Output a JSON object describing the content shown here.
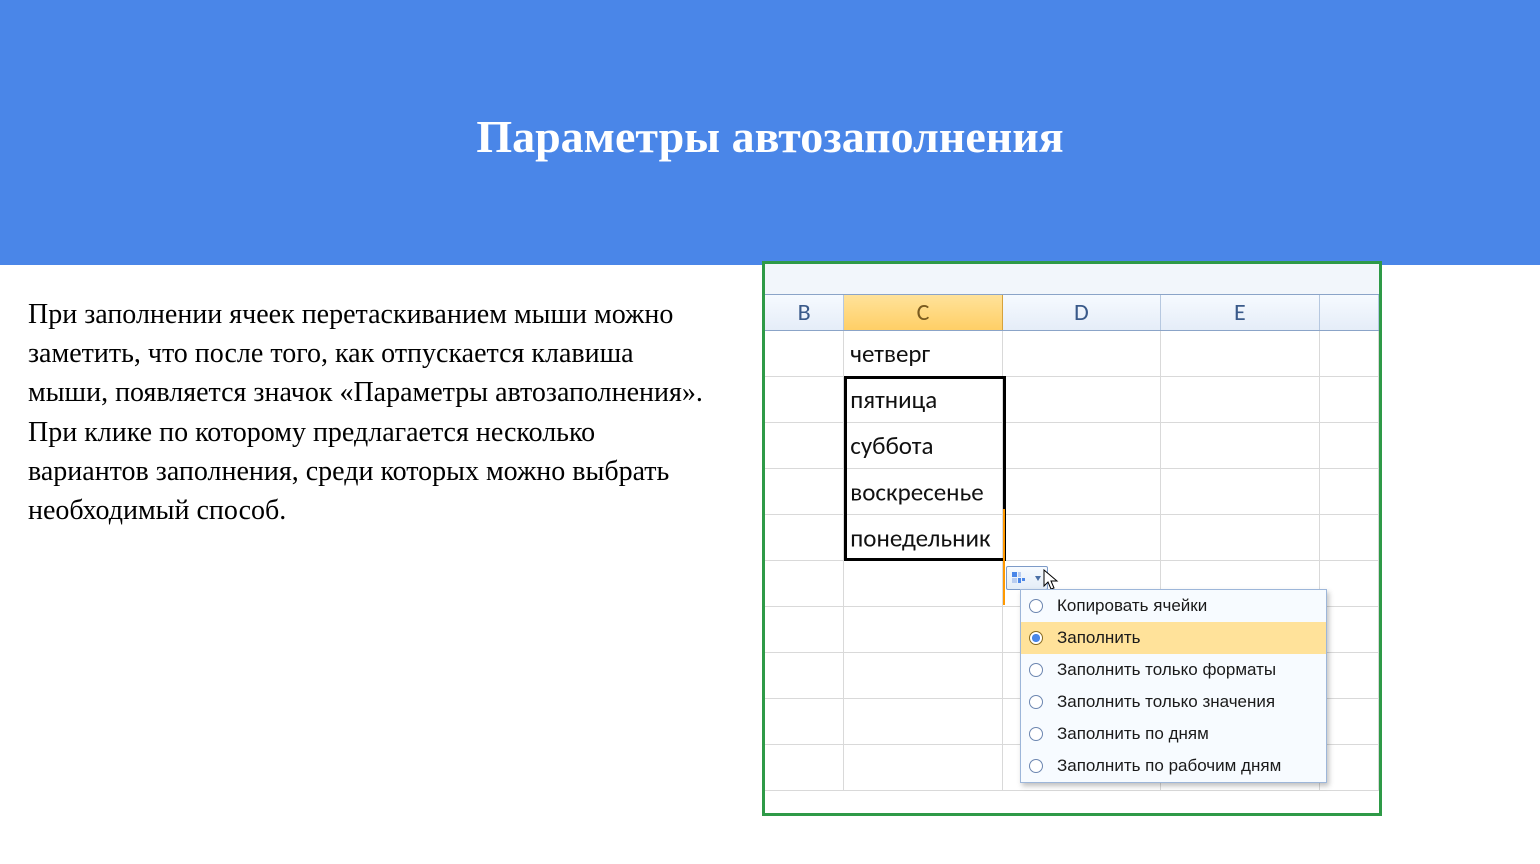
{
  "slide": {
    "title": "Параметры автозаполнения",
    "body": "При заполнении ячеек перетаскиванием мыши можно заметить, что после того, как отпускается клавиша мыши, появляется значок «Параметры автозаполнения». При клике по которому предлагается несколько вариантов заполнения, среди которых можно выбрать необходимый способ."
  },
  "excel": {
    "columns": {
      "B": "B",
      "C": "C",
      "D": "D",
      "E": "E"
    },
    "cells": {
      "c1": "четверг",
      "c2": "пятница",
      "c3": "суббота",
      "c4": "воскресенье",
      "c5": "понедельник"
    },
    "autofill_menu": {
      "opt1": "Копировать ячейки",
      "opt2": "Заполнить",
      "opt3": "Заполнить только форматы",
      "opt4": "Заполнить только значения",
      "opt5": "Заполнить по дням",
      "opt6": "Заполнить по рабочим дням"
    }
  }
}
